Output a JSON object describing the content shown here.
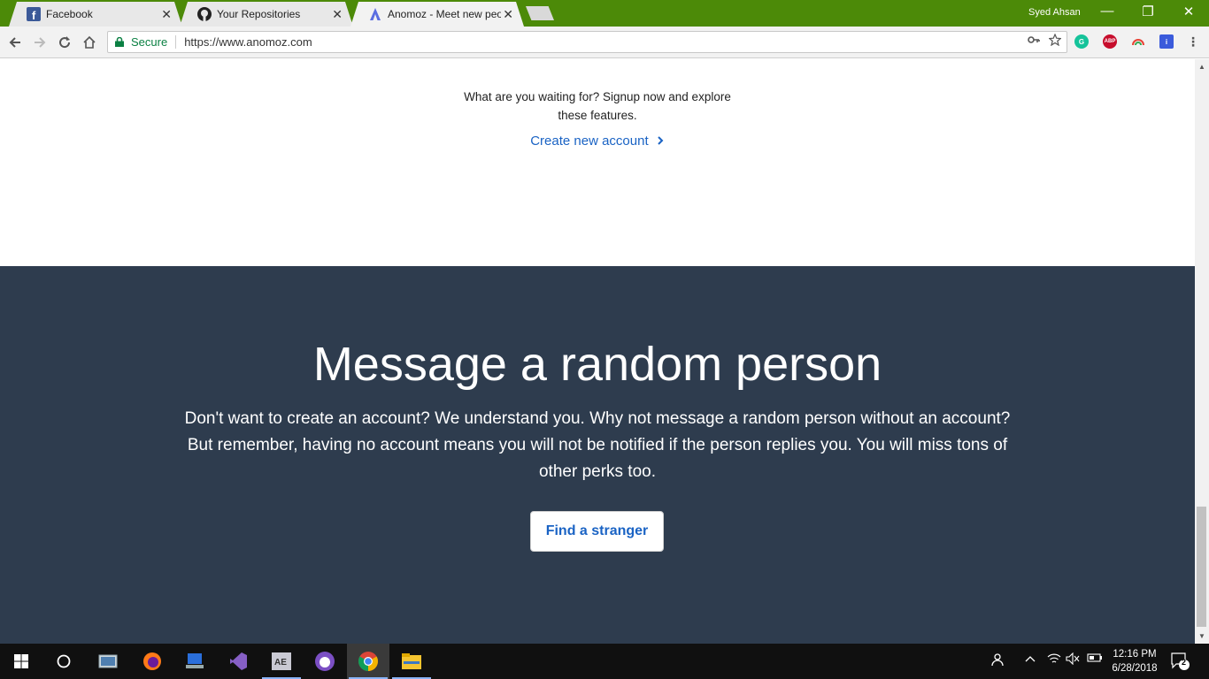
{
  "browser": {
    "tabs": [
      {
        "title": "Facebook",
        "icon": "facebook-icon",
        "active": false
      },
      {
        "title": "Your Repositories",
        "icon": "github-icon",
        "active": false
      },
      {
        "title": "Anomoz - Meet new peo",
        "icon": "anomoz-icon",
        "active": true
      }
    ],
    "tab_close": "✕",
    "profile_name": "Syed Ahsan",
    "window_controls": {
      "minimize": "—",
      "restore": "❐",
      "close": "✕"
    },
    "address_bar": {
      "secure_label": "Secure",
      "url": "https://www.anomoz.com"
    },
    "colors": {
      "titlebar": "#4c8a08",
      "secure": "#0b8043"
    }
  },
  "page": {
    "cta_line1": "What are you waiting for? Signup now and explore",
    "cta_line2": "these features.",
    "create_account_link": "Create new account",
    "hero_title": "Message a random person",
    "hero_line1": "Don't want to create an account? We understand you. Why not message a random person without an account?",
    "hero_line2": "But remember, having no account means you will not be notified if the person replies you. You will miss tons of",
    "hero_line3": "other perks too.",
    "find_stranger_button": "Find a stranger",
    "colors": {
      "dark_section": "#2e3c4e",
      "link": "#1a63c4"
    }
  },
  "taskbar": {
    "time": "12:16 PM",
    "date": "6/28/2018",
    "notification_count": "2"
  }
}
